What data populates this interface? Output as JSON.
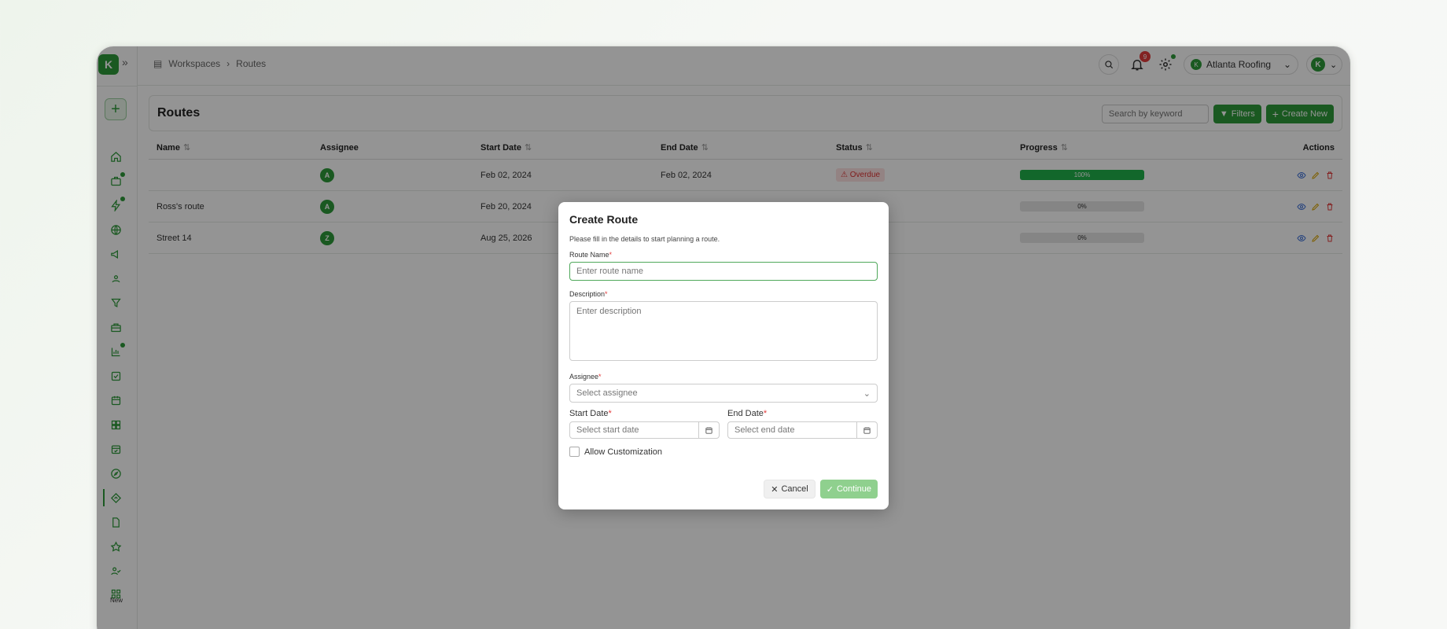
{
  "app": {
    "logo_letter": "K",
    "expand_icon": "»"
  },
  "sidebar": {
    "new_label": "New"
  },
  "breadcrumb": {
    "items": [
      "Workspaces",
      "Routes"
    ]
  },
  "topbar": {
    "notification_count": "9",
    "org_name": "Atlanta Roofing",
    "org_logo_letter": "K",
    "user_initial": "K"
  },
  "header": {
    "title": "Routes",
    "search_placeholder": "Search by keyword",
    "filters_label": "Filters",
    "create_label": "Create New"
  },
  "table": {
    "columns": {
      "name": "Name",
      "assignee": "Assignee",
      "start_date": "Start Date",
      "end_date": "End Date",
      "status": "Status",
      "progress": "Progress",
      "actions": "Actions"
    },
    "rows": [
      {
        "name": "",
        "assignee": "A",
        "start_date": "Feb 02, 2024",
        "end_date": "Feb 02, 2024",
        "status": "Overdue",
        "progress": "100%",
        "progress_value": 100
      },
      {
        "name": "Ross's route",
        "assignee": "A",
        "start_date": "Feb 20, 2024",
        "end_date": "",
        "status": "",
        "progress": "0%",
        "progress_value": 0
      },
      {
        "name": "Street 14",
        "assignee": "Z",
        "start_date": "Aug 25, 2026",
        "end_date": "",
        "status": "",
        "progress": "0%",
        "progress_value": 0
      }
    ]
  },
  "modal": {
    "title": "Create Route",
    "subtitle": "Please fill in the details to start planning a route.",
    "route_name_label": "Route Name",
    "route_name_placeholder": "Enter route name",
    "description_label": "Description",
    "description_placeholder": "Enter description",
    "assignee_label": "Assignee",
    "assignee_placeholder": "Select assignee",
    "start_date_label": "Start Date",
    "start_date_placeholder": "Select start date",
    "end_date_label": "End Date",
    "end_date_placeholder": "Select end date",
    "allow_customization_label": "Allow Customization",
    "cancel_label": "Cancel",
    "continue_label": "Continue",
    "required_mark": "*"
  },
  "colors": {
    "brand_green": "#2e9a3a",
    "danger": "#e23b3b",
    "progress_green": "#1fb24a"
  }
}
